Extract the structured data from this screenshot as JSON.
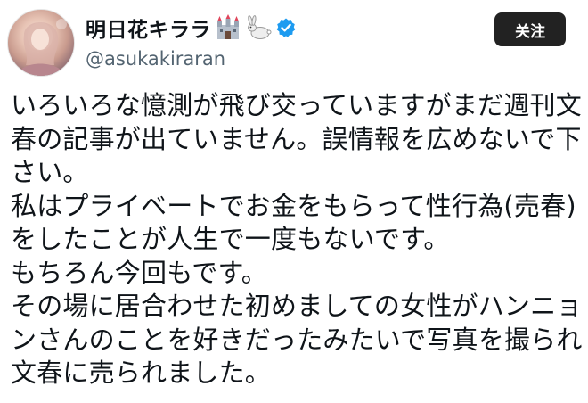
{
  "profile": {
    "display_name": "明日花キララ",
    "handle": "@asukakiraran",
    "name_emoji_icons": [
      "castle-icon",
      "rabbit-icon"
    ],
    "verified": true,
    "verified_color": "#1d9bf0"
  },
  "actions": {
    "follow_label": "关注"
  },
  "tweet": {
    "lines": [
      "いろいろな憶測が飛び交っていますがまだ週刊文",
      "春の記事が出ていません。誤情報を広めないで下",
      "さい。",
      "私はプライベートでお金をもらって性行為(売春)",
      "をしたことが人生で一度もないです。",
      "もちろん今回もです。",
      "その場に居合わせた初めましての女性がハンニョ",
      "ンさんのことを好きだったみたいで写真を撮られ",
      "文春に売られました。"
    ]
  }
}
